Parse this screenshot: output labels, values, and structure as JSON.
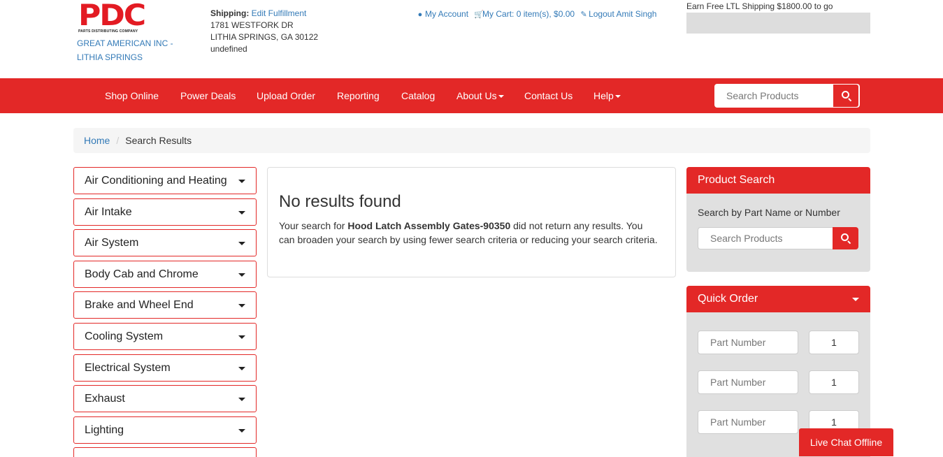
{
  "header": {
    "logo_text": "PDC",
    "logo_subtext": "PARTS DISTRIBUTING COMPANY",
    "company_line1": "GREAT AMERICAN INC -",
    "company_line2": "LITHIA SPRINGS",
    "shipping_label": "Shipping:",
    "shipping_link": "Edit Fulfillment",
    "address_line1": "1781 WESTFORK DR",
    "address_line2": "LITHIA SPRINGS, GA 30122",
    "address_line3": "undefined",
    "my_account": "My Account",
    "my_cart": "My Cart: 0 item(s), $0.00",
    "logout": "Logout Amit Singh",
    "ltl_text": "Earn Free LTL Shipping $1800.00 to go"
  },
  "nav": {
    "items": [
      "Shop Online",
      "Power Deals",
      "Upload Order",
      "Reporting",
      "Catalog",
      "About Us",
      "Contact Us",
      "Help"
    ],
    "search_placeholder": "Search Products"
  },
  "breadcrumb": {
    "home": "Home",
    "current": "Search Results"
  },
  "categories": [
    "Air Conditioning and Heating",
    "Air Intake",
    "Air System",
    "Body Cab and Chrome",
    "Brake and Wheel End",
    "Cooling System",
    "Electrical System",
    "Exhaust",
    "Lighting"
  ],
  "main": {
    "heading": "No results found",
    "msg_prefix": "Your search for ",
    "query": "Hood Latch Assembly Gates-90350",
    "msg_suffix": " did not return any results. You can broaden your search by using fewer search criteria or reducing your search criteria."
  },
  "product_search": {
    "title": "Product Search",
    "label": "Search by Part Name or Number",
    "placeholder": "Search Products"
  },
  "quick_order": {
    "title": "Quick Order",
    "part_placeholder": "Part Number",
    "rows": [
      {
        "qty": "1"
      },
      {
        "qty": "1"
      },
      {
        "qty": "1"
      }
    ]
  },
  "chat": {
    "label": "Live Chat Offline"
  },
  "colors": {
    "brand_red": "#e32827",
    "link_blue": "#337ab7"
  }
}
